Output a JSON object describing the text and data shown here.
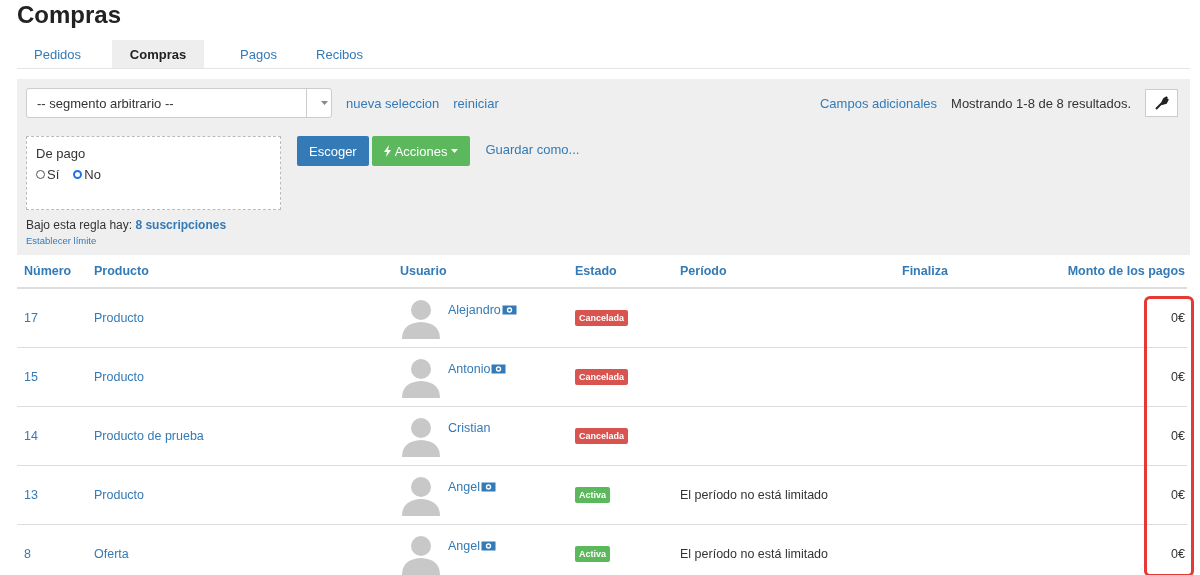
{
  "page_title": "Compras",
  "tabs": [
    {
      "label": "Pedidos",
      "selected": false
    },
    {
      "label": "Compras",
      "selected": true
    },
    {
      "label": "Pagos",
      "selected": false
    },
    {
      "label": "Recibos",
      "selected": false
    }
  ],
  "filter": {
    "segment": "-- segmento arbitrario --",
    "links": [
      "nueva seleccion",
      "reiniciar"
    ],
    "extra_fields": "Campos adicionales",
    "results": "Mostrando 1-8 de 8 resultados.",
    "rule": {
      "label": "De pago",
      "options": [
        {
          "label": "Sí",
          "selected": false
        },
        {
          "label": "No",
          "selected": true
        }
      ]
    },
    "buttons": [
      {
        "label": "Escoger",
        "kind": "primary"
      },
      {
        "label": "Acciones",
        "kind": "actions"
      }
    ],
    "save_link": "Guardar como...",
    "summary": "Bajo esta regla hay: **8 suscripciones**",
    "limit_link": "Establecer límite"
  },
  "table": {
    "columns": [
      "Número",
      "Producto",
      "Usuario",
      "Estado",
      "Período",
      "Finaliza",
      "Monto de los pagos"
    ],
    "annotation": {
      "kind": "highlight_frame"
    },
    "rows": [
      {
        "number": "17",
        "product": "Producto",
        "user": "Alejandro",
        "payment_icon": true,
        "status": {
          "label": "Cancelada",
          "kind": "cancelled"
        },
        "amount": "0€"
      },
      {
        "number": "15",
        "product": "Producto",
        "user": "Antonio",
        "payment_icon": true,
        "status": {
          "label": "Cancelada",
          "kind": "cancelled"
        },
        "amount": "0€"
      },
      {
        "number": "14",
        "product": "Producto de prueba",
        "user": "Cristian",
        "payment_icon": false,
        "status": {
          "label": "Cancelada",
          "kind": "cancelled"
        },
        "amount": "0€"
      },
      {
        "number": "13",
        "product": "Producto",
        "user": "Angel",
        "payment_icon": true,
        "status": {
          "label": "Activa",
          "kind": "active"
        },
        "period": "El período no está limitado",
        "amount": "0€"
      },
      {
        "number": "8",
        "product": "Oferta",
        "user": "Angel",
        "payment_icon": true,
        "status": {
          "label": "Activa",
          "kind": "active"
        },
        "period": "El período no está limitado",
        "amount": "0€"
      }
    ]
  }
}
